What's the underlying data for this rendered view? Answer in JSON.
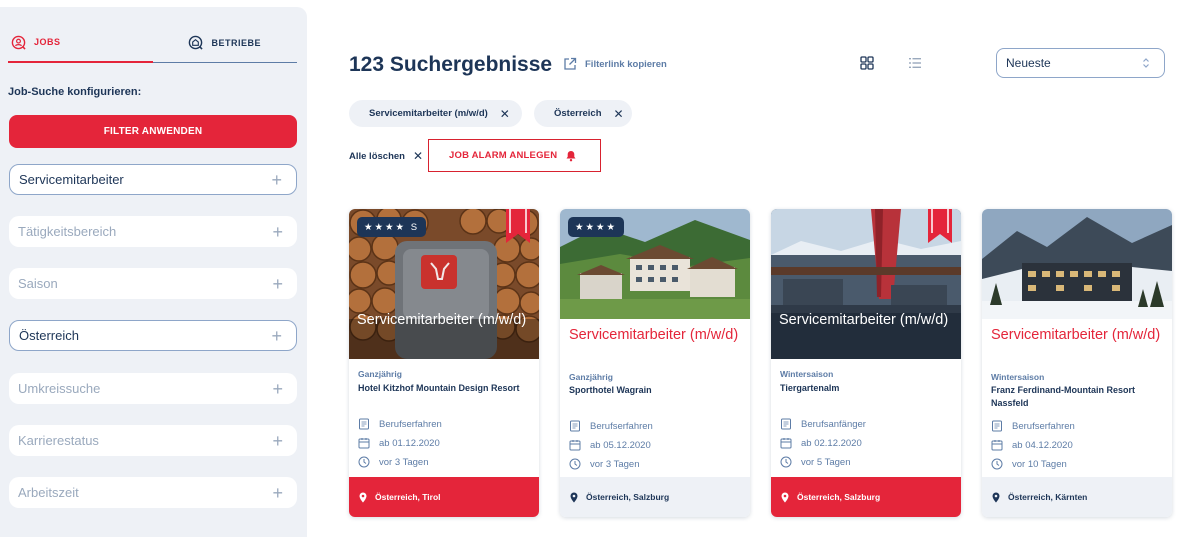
{
  "sidebar": {
    "tabs": [
      {
        "label": "JOBS",
        "icon": "person-search-icon",
        "active": true
      },
      {
        "label": "BETRIEBE",
        "icon": "building-search-icon",
        "active": false
      }
    ],
    "heading": "Job-Suche konfigurieren:",
    "apply_button": "FILTER ANWENDEN",
    "filters": [
      {
        "label": "Servicemitarbeiter",
        "selected": true
      },
      {
        "label": "Tätigkeitsbereich",
        "selected": false
      },
      {
        "label": "Saison",
        "selected": false
      },
      {
        "label": "Österreich",
        "selected": true
      },
      {
        "label": "Umkreissuche",
        "selected": false
      },
      {
        "label": "Karrierestatus",
        "selected": false
      },
      {
        "label": "Arbeitszeit",
        "selected": false
      }
    ],
    "plus_symbol": "+"
  },
  "header": {
    "results_title": "123 Suchergebnisse",
    "copy_link": "Filterlink kopieren",
    "sort_value": "Neueste"
  },
  "chips": [
    {
      "label": "Servicemitarbeiter (m/w/d)"
    },
    {
      "label": "Österreich"
    }
  ],
  "clear_all": "Alle löschen",
  "alarm_button": "JOB ALARM ANLEGEN",
  "colors": {
    "accent": "#e4253a",
    "navy": "#1d3557",
    "muted": "#5d7ca6",
    "panel": "#eef1f6"
  },
  "cards": [
    {
      "stars": "★★★★ S",
      "bookmarked": true,
      "title": "Servicemitarbeiter (m/w/d)",
      "season": "Ganzjährig",
      "company": "Hotel Kitzhof Mountain Design Resort",
      "experience": "Berufserfahren",
      "start": "ab 01.12.2020",
      "posted": "vor 3 Tagen",
      "location": "Österreich, Tirol",
      "highlighted": true
    },
    {
      "stars": "★★★★",
      "bookmarked": false,
      "title": "Servicemitarbeiter (m/w/d)",
      "season": "Ganzjährig",
      "company": "Sporthotel Wagrain",
      "experience": "Berufserfahren",
      "start": "ab 05.12.2020",
      "posted": "vor 3 Tagen",
      "location": "Österreich, Salzburg",
      "highlighted": false
    },
    {
      "stars": "",
      "bookmarked": true,
      "title": "Servicemitarbeiter (m/w/d)",
      "season": "Wintersaison",
      "company": "Tiergartenalm",
      "experience": "Berufsanfänger",
      "start": "ab 02.12.2020",
      "posted": "vor 5 Tagen",
      "location": "Österreich, Salzburg",
      "highlighted": true
    },
    {
      "stars": "",
      "bookmarked": false,
      "title": "Servicemitarbeiter (m/w/d)",
      "season": "Wintersaison",
      "company": "Franz Ferdinand-Mountain Resort Nassfeld",
      "experience": "Berufserfahren",
      "start": "ab 04.12.2020",
      "posted": "vor 10 Tagen",
      "location": "Österreich, Kärnten",
      "highlighted": false
    }
  ]
}
